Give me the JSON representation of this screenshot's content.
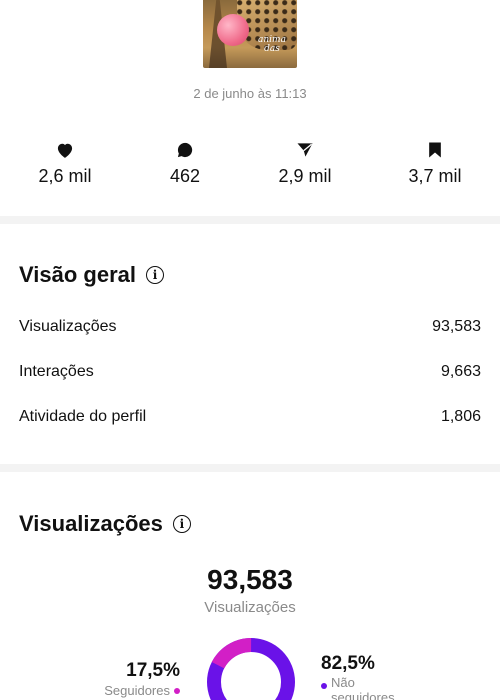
{
  "post": {
    "thumbnail_text": "anima das",
    "date": "2 de junho às 11:13"
  },
  "stats": [
    {
      "icon": "heart-icon",
      "value": "2,6 mil"
    },
    {
      "icon": "comment-icon",
      "value": "462"
    },
    {
      "icon": "share-icon",
      "value": "2,9 mil"
    },
    {
      "icon": "bookmark-icon",
      "value": "3,7 mil"
    }
  ],
  "overview": {
    "title": "Visão geral",
    "rows": [
      {
        "label": "Visualizações",
        "value": "93,583"
      },
      {
        "label": "Interações",
        "value": "9,663"
      },
      {
        "label": "Atividade do perfil",
        "value": "1,806"
      }
    ]
  },
  "views": {
    "title": "Visualizações",
    "total": "93,583",
    "total_label": "Visualizações",
    "followers_pct": "17,5%",
    "followers_label": "Seguidores",
    "nonfollowers_pct": "82,5%",
    "nonfollowers_label_line1": "Não",
    "nonfollowers_label_line2": "seguidores",
    "followers_fraction": 0.175,
    "colors": {
      "followers": "#d21fc6",
      "nonfollowers": "#6a12e8"
    }
  }
}
